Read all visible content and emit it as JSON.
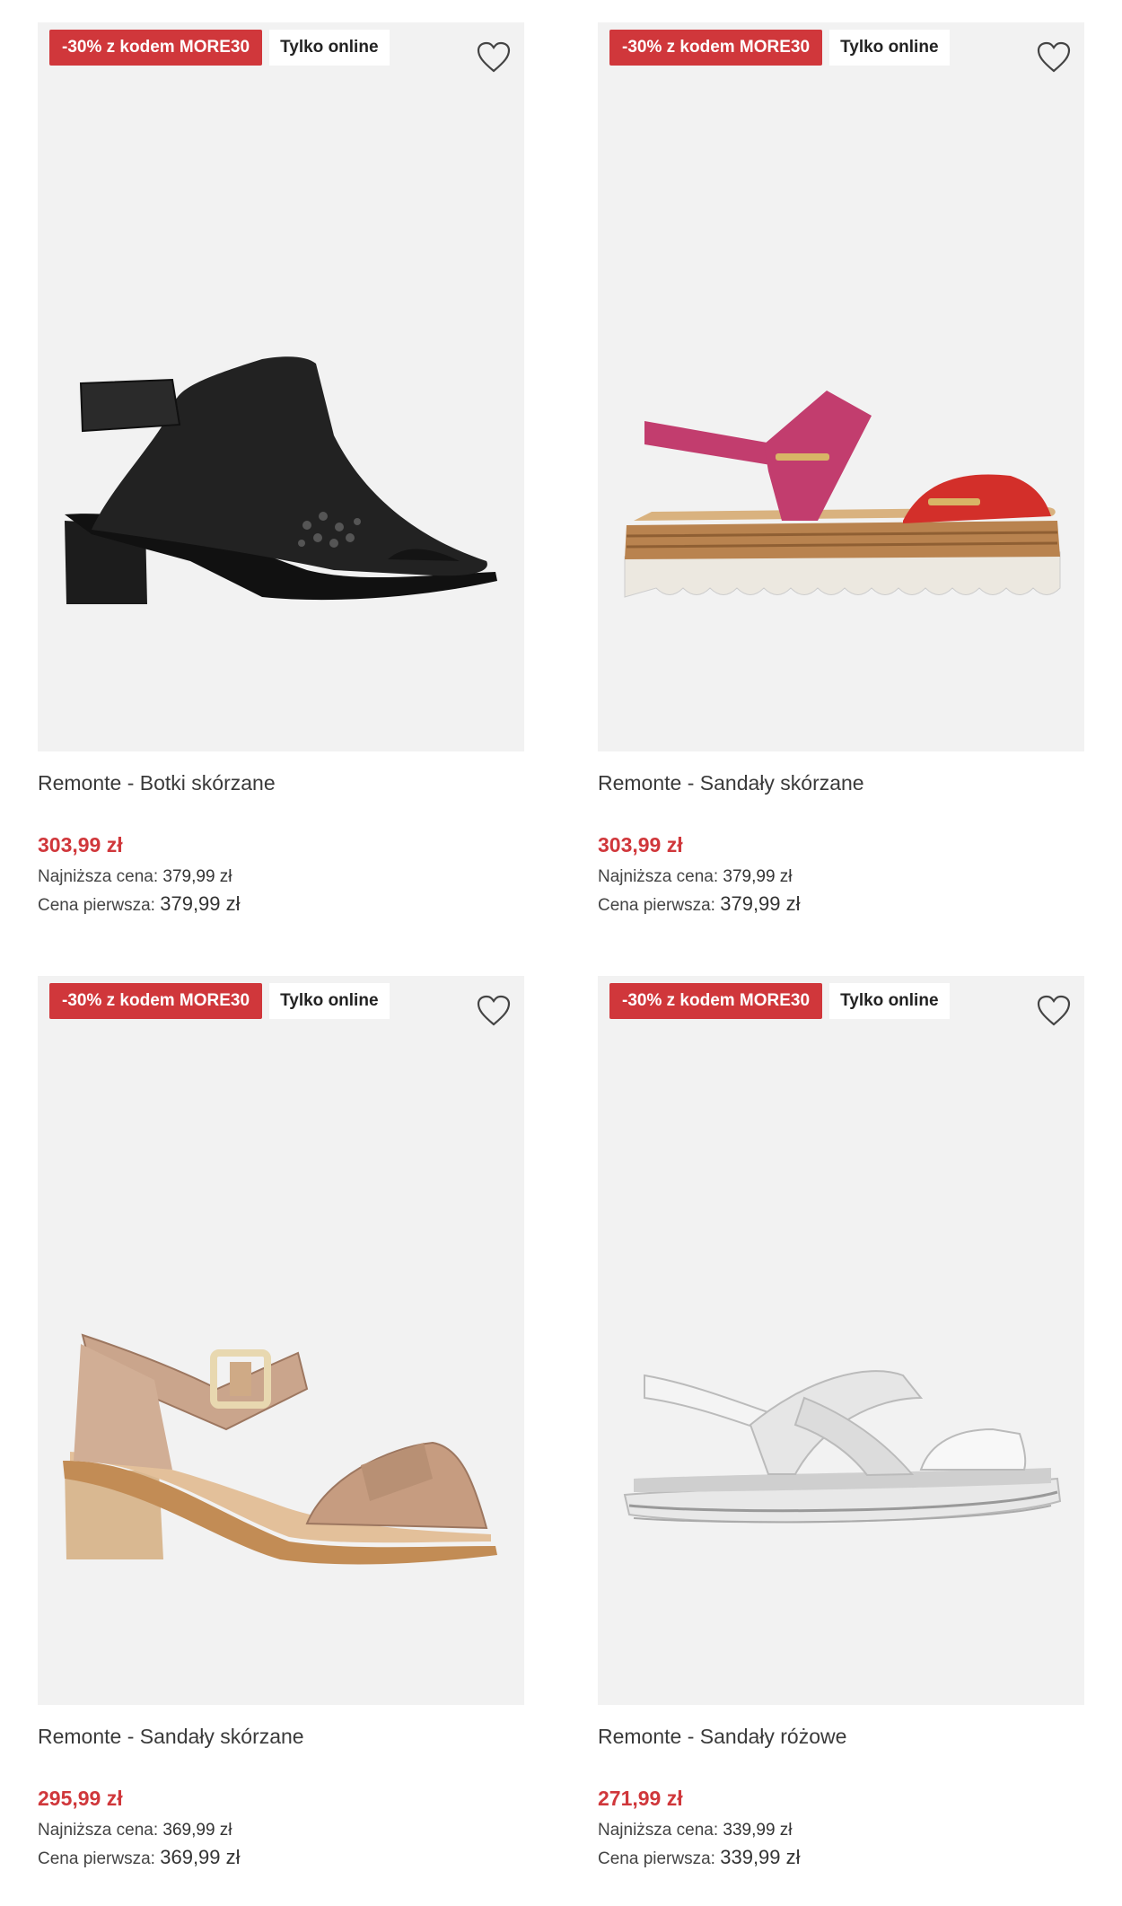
{
  "products": [
    {
      "promo": "-30% z kodem MORE30",
      "badge": "Tylko online",
      "name": "Remonte - Botki skórzane",
      "price": "303,99 zł",
      "lowest_label": "Najniższa cena:",
      "lowest_value": "379,99 zł",
      "first_label": "Cena pierwsza:",
      "first_value": "379,99 zł",
      "favorite_icon": "heart-outline-icon"
    },
    {
      "promo": "-30% z kodem MORE30",
      "badge": "Tylko online",
      "name": "Remonte - Sandały skórzane",
      "price": "303,99 zł",
      "lowest_label": "Najniższa cena:",
      "lowest_value": "379,99 zł",
      "first_label": "Cena pierwsza:",
      "first_value": "379,99 zł",
      "favorite_icon": "heart-outline-icon"
    },
    {
      "promo": "-30% z kodem MORE30",
      "badge": "Tylko online",
      "name": "Remonte - Sandały skórzane",
      "price": "295,99 zł",
      "lowest_label": "Najniższa cena:",
      "lowest_value": "369,99 zł",
      "first_label": "Cena pierwsza:",
      "first_value": "369,99 zł",
      "favorite_icon": "heart-outline-icon"
    },
    {
      "promo": "-30% z kodem MORE30",
      "badge": "Tylko online",
      "name": "Remonte - Sandały różowe",
      "price": "271,99 zł",
      "lowest_label": "Najniższa cena:",
      "lowest_value": "339,99 zł",
      "first_label": "Cena pierwsza:",
      "first_value": "339,99 zł",
      "favorite_icon": "heart-outline-icon"
    }
  ],
  "colors": {
    "promo_badge": "#d0373b",
    "price": "#d0373b",
    "image_background": "#f2f2f2"
  }
}
